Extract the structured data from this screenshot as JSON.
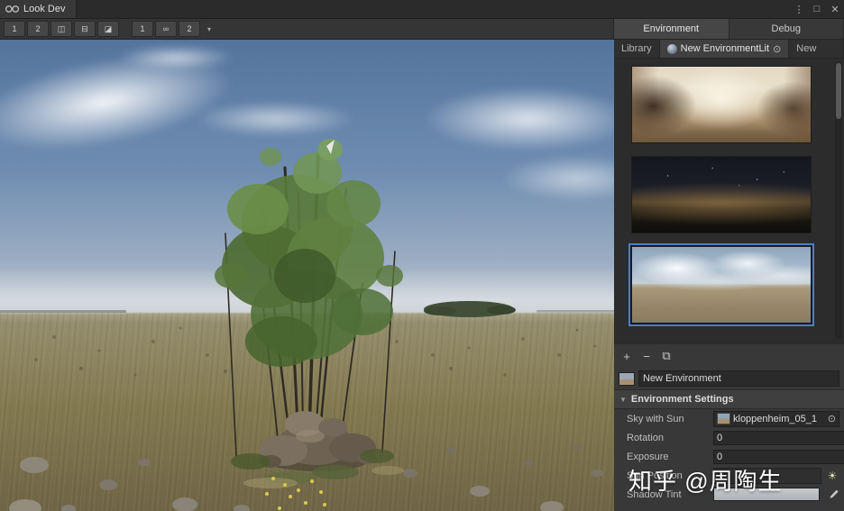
{
  "titlebar": {
    "title": "Look Dev",
    "menu_icon": "⋮",
    "maximize_icon": "□",
    "close_icon": "✕"
  },
  "toolbar": {
    "layout1": "1",
    "layout2": "2",
    "split_vertical": "◫",
    "split_horizontal": "⊟",
    "split_diagonal": "◪",
    "camera1": "1",
    "link_icon": "∞",
    "camera2": "2",
    "dropdown": "▾"
  },
  "panel": {
    "tabs": [
      {
        "label": "Environment",
        "active": true
      },
      {
        "label": "Debug",
        "active": false
      }
    ],
    "subtabs": {
      "library": "Library",
      "current": "New EnvironmentLit",
      "picker": "⊙",
      "new_tab": "New"
    },
    "environments": [
      {
        "name": "interior-room-hdri",
        "selected": false
      },
      {
        "name": "night-sky-hdri",
        "selected": false
      },
      {
        "name": "cloudy-grassland-hdri",
        "selected": true
      }
    ],
    "list_tools": {
      "add": "+",
      "remove": "−",
      "duplicate": "⧉"
    },
    "name_field": {
      "value": "New Environment"
    },
    "settings": {
      "header": "Environment Settings",
      "fold_icon": "▼",
      "sky_with_sun": {
        "label": "Sky with Sun",
        "value": "kloppenheim_05_1",
        "picker": "⊙"
      },
      "rotation": {
        "label": "Rotation",
        "value": "0"
      },
      "exposure": {
        "label": "Exposure",
        "value": "0"
      },
      "sun_position": {
        "label": "Sun Position",
        "sun_icon": "☀"
      },
      "shadow_tint": {
        "label": "Shadow Tint",
        "swatch_color": "#b9bdc1"
      }
    }
  },
  "watermark": "知乎 @周陶生",
  "colors": {
    "selection_blue": "#4e7ec2",
    "panel_bg": "#383838",
    "dark_bg": "#2b2b2b"
  }
}
